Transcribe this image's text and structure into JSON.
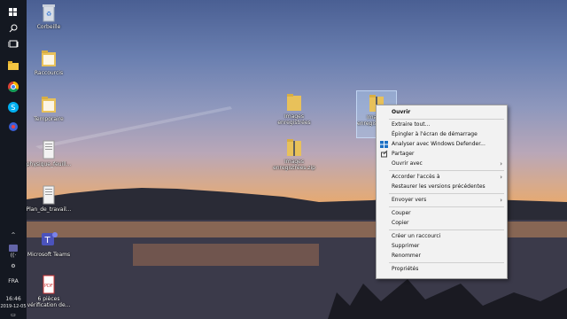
{
  "taskbar": {
    "time": "16:46",
    "date": "2019-12-05",
    "lang": "FRA",
    "icons": [
      "windows-start-icon",
      "search-icon",
      "task-view-icon",
      "file-explorer-icon",
      "chrome-icon",
      "skype-icon",
      "app-icon",
      "teams-icon"
    ]
  },
  "desktop_icons": [
    {
      "label": "Corbeille"
    },
    {
      "label": "Raccourcis"
    },
    {
      "label": "Temporaire"
    },
    {
      "label": "physique_feuill..."
    },
    {
      "label": "Plan_de_travail..."
    },
    {
      "label": "Microsoft Teams"
    },
    {
      "label": "6 pièces",
      "label2": "vérification de..."
    },
    {
      "label": "Images",
      "label2": "enregistrées"
    },
    {
      "label": "Images",
      "label2": "enregistrées.zip"
    },
    {
      "label": "Images",
      "label2": "enregistrées (2)"
    }
  ],
  "context_menu": {
    "items": [
      {
        "label": "Ouvrir",
        "bold": true
      },
      {
        "label": "Extraire tout..."
      },
      {
        "label": "Épingler à l'écran de démarrage"
      },
      {
        "label": "Analyser avec Windows Defender..."
      },
      {
        "label": "Partager"
      },
      {
        "label": "Ouvrir avec",
        "submenu": true
      },
      {
        "label": "Accorder l'accès à",
        "submenu": true
      },
      {
        "label": "Restaurer les versions précédentes"
      },
      {
        "label": "Envoyer vers",
        "submenu": true
      },
      {
        "label": "Couper"
      },
      {
        "label": "Copier"
      },
      {
        "label": "Créer un raccourci"
      },
      {
        "label": "Supprimer"
      },
      {
        "label": "Renommer"
      },
      {
        "label": "Propriétés"
      }
    ]
  },
  "colors": {
    "taskbar": "#141821",
    "menu_bg": "#f2f2f2",
    "folder": "#e8c15a",
    "zip_stripe": "#5f5f5f",
    "defender_blue": "#1a6fc4"
  }
}
